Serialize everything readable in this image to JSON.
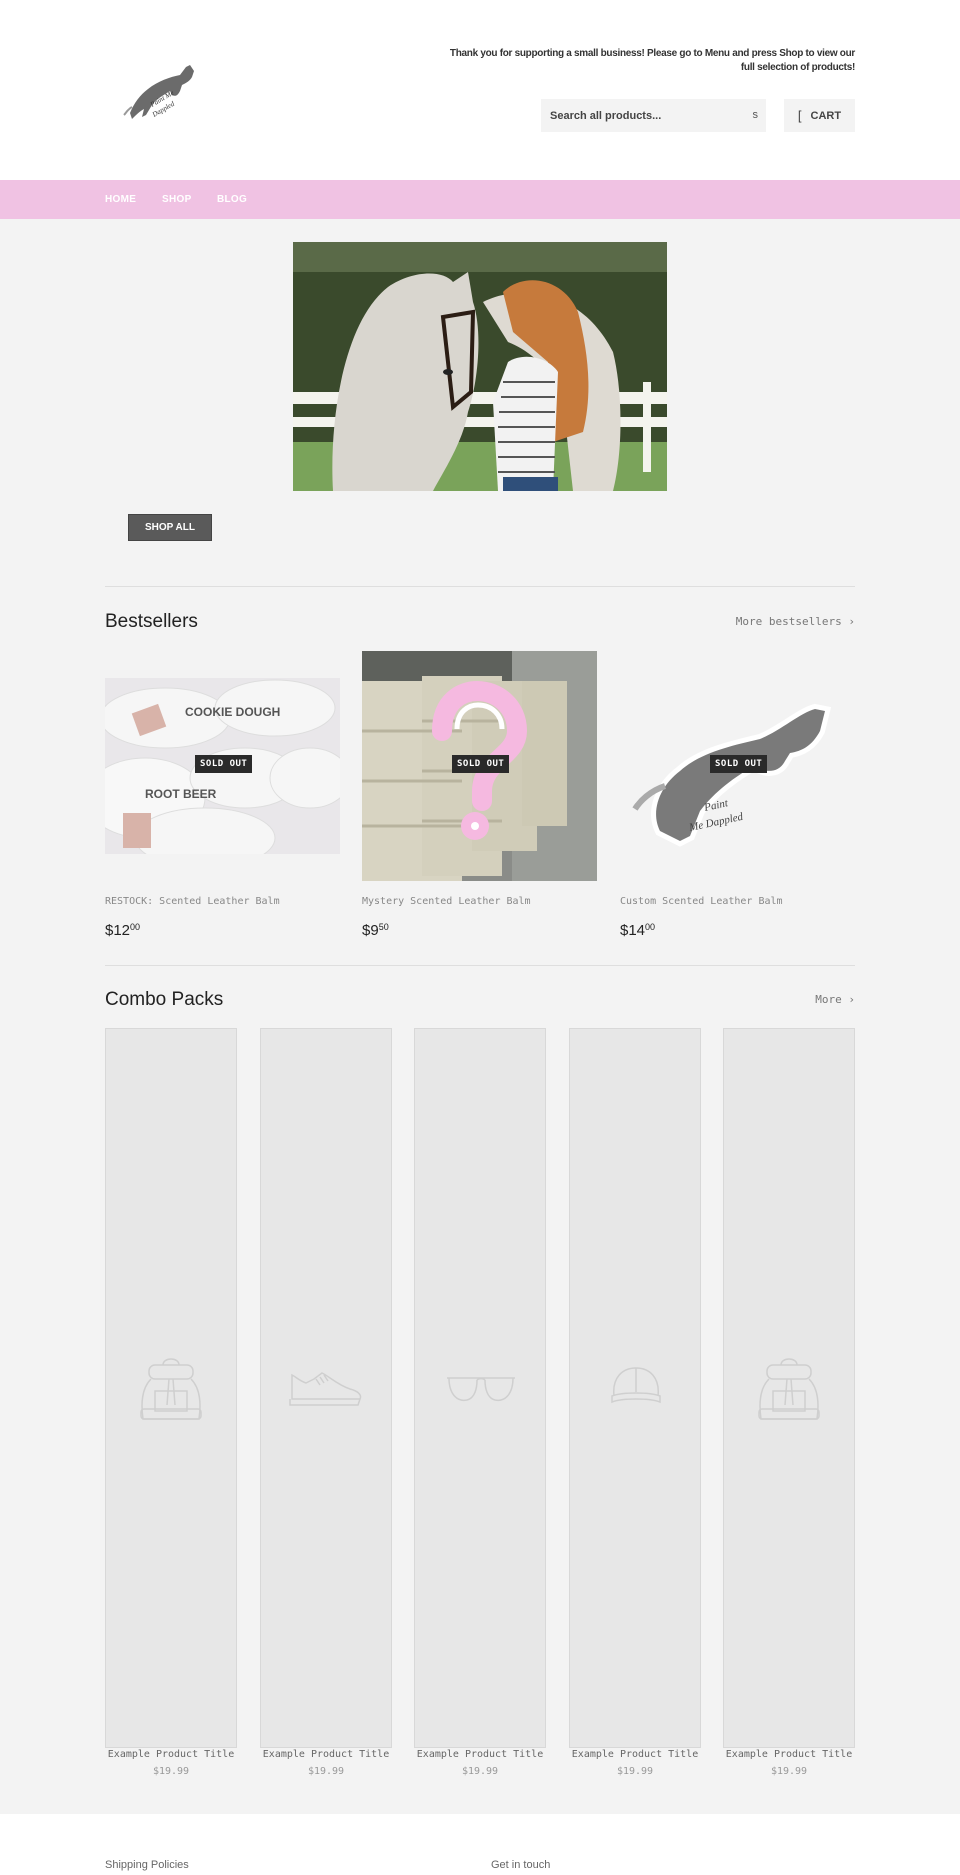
{
  "header": {
    "logo_alt": "Paint Me Dappled",
    "tagline": "Thank you for supporting a small business! Please go to Menu and press Shop to view our full selection of products!",
    "search": {
      "placeholder": "Search all products...",
      "button_glyph": "s"
    },
    "cart": {
      "icon_glyph": "[",
      "label": "CART"
    }
  },
  "nav": {
    "items": [
      {
        "label": "HOME"
      },
      {
        "label": "SHOP"
      },
      {
        "label": "BLOG"
      }
    ]
  },
  "hero": {
    "alt": "Girl with red hair nuzzling a dappled grey horse by a white fence",
    "button_label": "SHOP ALL"
  },
  "bestsellers": {
    "title": "Bestsellers",
    "more_link": "More bestsellers ›",
    "products": [
      {
        "title": "RESTOCK: Scented Leather Balm",
        "price_main": "$12",
        "price_cents": "00",
        "badge": "SOLD OUT"
      },
      {
        "title": "Mystery Scented Leather Balm",
        "price_main": "$9",
        "price_cents": "50",
        "badge": "SOLD OUT"
      },
      {
        "title": "Custom Scented Leather Balm",
        "price_main": "$14",
        "price_cents": "00",
        "badge": "SOLD OUT"
      }
    ]
  },
  "combo_packs": {
    "title": "Combo Packs",
    "more_link": "More ›",
    "products": [
      {
        "title": "Example Product Title",
        "price": "$19.99",
        "icon": "backpack-icon"
      },
      {
        "title": "Example Product Title",
        "price": "$19.99",
        "icon": "sneaker-icon"
      },
      {
        "title": "Example Product Title",
        "price": "$19.99",
        "icon": "glasses-icon"
      },
      {
        "title": "Example Product Title",
        "price": "$19.99",
        "icon": "cap-icon"
      },
      {
        "title": "Example Product Title",
        "price": "$19.99",
        "icon": "backpack-icon"
      }
    ]
  },
  "footer": {
    "col1_heading": "Shipping Policies",
    "col2_heading": "Get in touch"
  }
}
